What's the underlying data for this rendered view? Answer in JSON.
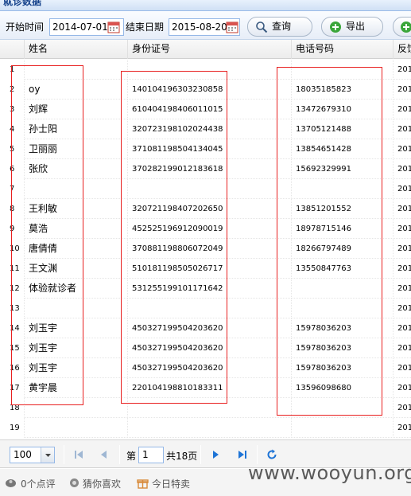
{
  "title": "就诊数据",
  "toolbar": {
    "start_label": "开始时间",
    "start_value": "2014-07-01",
    "end_label": "结束日期",
    "end_value": "2015-08-20",
    "query_label": "查询",
    "export_label": "导出"
  },
  "columns": [
    "姓名",
    "身份证号",
    "电话号码",
    "反馈"
  ],
  "rows": [
    {
      "n": "1",
      "name": "",
      "id": "",
      "tel": "",
      "last": "201"
    },
    {
      "n": "2",
      "name": "oy",
      "id": "140104196303230858",
      "tel": "18035185823",
      "last": "201"
    },
    {
      "n": "3",
      "name": "刘辉",
      "id": "610404198406011015",
      "tel": "13472679310",
      "last": "201"
    },
    {
      "n": "4",
      "name": "孙士阳",
      "id": "320723198102024438",
      "tel": "13705121488",
      "last": "201"
    },
    {
      "n": "5",
      "name": "卫丽丽",
      "id": "371081198504134045",
      "tel": "13854651428",
      "last": "201"
    },
    {
      "n": "6",
      "name": "张欣",
      "id": "370282199012183618",
      "tel": "15692329991",
      "last": "201"
    },
    {
      "n": "7",
      "name": "",
      "id": "",
      "tel": "",
      "last": "201"
    },
    {
      "n": "8",
      "name": "王利敏",
      "id": "320721198407202650",
      "tel": "13851201552",
      "last": "201"
    },
    {
      "n": "9",
      "name": "莫浩",
      "id": "452525196912090019",
      "tel": "18978715146",
      "last": "201"
    },
    {
      "n": "10",
      "name": "唐倩倩",
      "id": "370881198806072049",
      "tel": "18266797489",
      "last": "201"
    },
    {
      "n": "11",
      "name": "王文渊",
      "id": "510181198505026717",
      "tel": "13550847763",
      "last": "201"
    },
    {
      "n": "12",
      "name": "体验就诊者",
      "id": "531255199101171642",
      "tel": "",
      "last": "201"
    },
    {
      "n": "13",
      "name": "",
      "id": "",
      "tel": "",
      "last": "201"
    },
    {
      "n": "14",
      "name": "刘玉宇",
      "id": "450327199504203620",
      "tel": "15978036203",
      "last": "201"
    },
    {
      "n": "15",
      "name": "刘玉宇",
      "id": "450327199504203620",
      "tel": "15978036203",
      "last": "201"
    },
    {
      "n": "16",
      "name": "刘玉宇",
      "id": "450327199504203620",
      "tel": "15978036203",
      "last": "201"
    },
    {
      "n": "17",
      "name": "黄宇晨",
      "id": "220104198810183311",
      "tel": "13596098680",
      "last": "201"
    },
    {
      "n": "18",
      "name": "",
      "id": "",
      "tel": "",
      "last": "201"
    },
    {
      "n": "19",
      "name": "",
      "id": "",
      "tel": "",
      "last": "201"
    }
  ],
  "pager": {
    "page_size": "100",
    "page_prefix": "第",
    "page_value": "1",
    "page_total": "共18页"
  },
  "status": {
    "reviews": "0个点评",
    "guess": "猜你喜欢",
    "today": "今日特卖"
  },
  "watermark": "www.wooyun.org",
  "colors": {
    "highlight_box": "#e82020",
    "accent": "#15428b"
  }
}
